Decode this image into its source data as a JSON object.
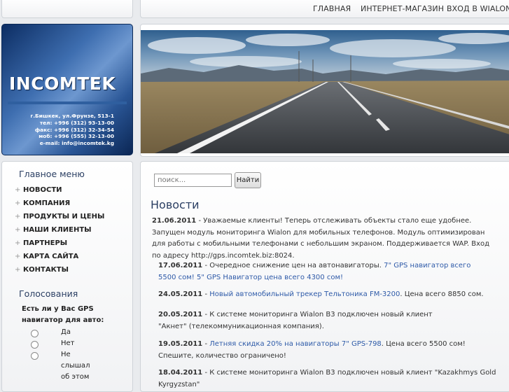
{
  "topnav": {
    "items": [
      "ГЛАВНАЯ",
      "ИНТЕРНЕТ-МАГАЗИН",
      "ВХОД В WIALON"
    ]
  },
  "logo": {
    "name": "INCOMTEK",
    "contacts": [
      "г.Бишкек, ул.Фрунзе, 513-1",
      "тел: +996 (312) 93-13-00",
      "факс: +996 (312) 32-34-54",
      "моб: +996 (555) 32-13-00",
      "e-mail: info@incomtek.kg"
    ]
  },
  "sidebar": {
    "menu_title": "Главное меню",
    "menu": [
      "НОВОСТИ",
      "КОМПАНИЯ",
      "ПРОДУКТЫ И ЦЕНЫ",
      "НАШИ КЛИЕНТЫ",
      "ПАРТНЕРЫ",
      "КАРТА САЙТА",
      "КОНТАКТЫ"
    ],
    "poll_title": "Голосования",
    "poll_question": "Есть ли у Вас GPS навигатор для авто:",
    "poll_options": [
      "Да",
      "Нет",
      "Не слышал об этом"
    ]
  },
  "search": {
    "placeholder": "поиск...",
    "button": "Найти"
  },
  "news": {
    "title": "Новости",
    "items": [
      {
        "date": "21.06.2011",
        "pre": " - Уважаемые клиенты! Теперь отслеживать объекты стало еще удобнее. Запущен модуль мониторинга Wialon для мобильных телефонов. Модуль оптимизирован для работы с мобильными телефонами с небольшим экраном. Поддерживается WAP. Вход по адресу http://gps.incomtek.biz:8024.",
        "link": "",
        "post": ""
      },
      {
        "date": "17.06.2011",
        "pre": " - Очередное снижение цен на автонавигаторы. ",
        "link": "7\" GPS навигатор всего 5500 сом! 5\" GPS Навигатор цена всего 4300 сом!",
        "post": ""
      },
      {
        "date": "24.05.2011",
        "pre": " - ",
        "link": "Новый автомобильный трекер Тельтоника FM-3200",
        "post": ". Цена всего 8850 сом."
      },
      {
        "date": "20.05.2011",
        "pre": " - К системе мониторинга Wialon B3 подключен новый клиент \"Акнет\" (телекоммуникационная компания).",
        "link": "",
        "post": ""
      },
      {
        "date": "19.05.2011",
        "pre": " - ",
        "link": "Летняя скидка 20% на навигаторы 7\" GPS-798",
        "post": ". Цена всего 5500 сом! Спешите, количество ограничено!"
      },
      {
        "date": "18.04.2011",
        "pre": " - К системе мониторинга Wialon B3 подключен новый клиент \"Kazakhmys Gold Kyrgyzstan\"",
        "link": "",
        "post": ""
      }
    ]
  },
  "colors": {
    "accent": "#2b3f63",
    "link": "#2e5aa8",
    "logo_blue": "#3e6eb0"
  }
}
